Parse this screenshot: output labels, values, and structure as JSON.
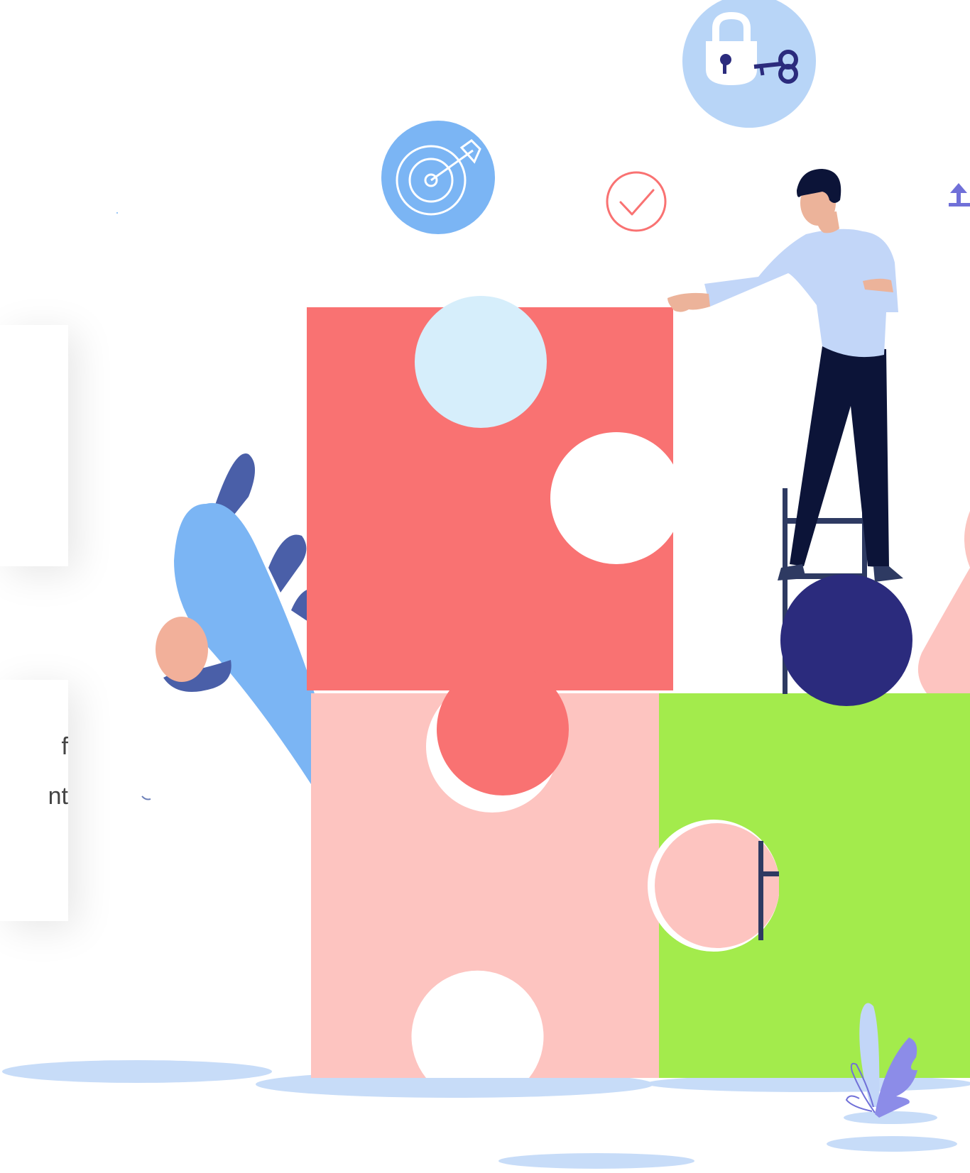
{
  "cards": [
    {
      "text_lines": []
    },
    {
      "text_lines": [
        "f",
        "nt"
      ]
    }
  ],
  "colors": {
    "puzzle_red": "#F97272",
    "puzzle_pink": "#FDC4C0",
    "puzzle_green": "#A3EB4C",
    "light_blue": "#D6EEFB",
    "blue": "#7BB5F4",
    "navy": "#2B2B7D",
    "dark_navy": "#0C1438",
    "shirt": "#C2D6F8",
    "skin": "#ECB39A",
    "shadow": "#C7DCF8"
  },
  "icons": [
    "target-icon",
    "lock-and-key-icon",
    "checkmark-icon",
    "upload-arrow-icon"
  ]
}
